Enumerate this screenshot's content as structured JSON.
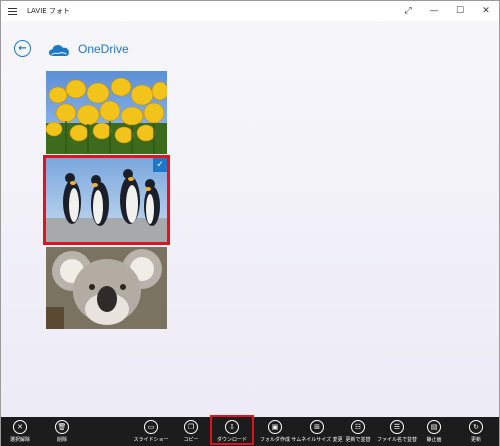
{
  "window": {
    "app_title": "LAVIE フォト",
    "controls": [
      "⤢",
      "—",
      "☐",
      "✕"
    ]
  },
  "header": {
    "back_icon": "back-arrow-icon",
    "location_icon": "onedrive-cloud-icon",
    "title": "OneDrive"
  },
  "photos": [
    {
      "subject": "tulips",
      "selected": false
    },
    {
      "subject": "penguins",
      "selected": true
    },
    {
      "subject": "koala",
      "selected": false
    }
  ],
  "colors": {
    "accent": "#1e78c8",
    "selection_outline": "#e0141e",
    "appbar_bg": "#1c1c1c"
  },
  "appbar": {
    "buttons": [
      {
        "label": "選択解除",
        "icon": "close-icon",
        "glyph": "✕"
      },
      {
        "label": "削除",
        "icon": "trash-icon",
        "glyph": "🗑"
      },
      {
        "label": "スライドショー",
        "icon": "slideshow-icon",
        "glyph": "▭"
      },
      {
        "label": "コピー",
        "icon": "copy-icon",
        "glyph": "❐"
      },
      {
        "label": "ダウンロード",
        "icon": "download-icon",
        "glyph": "⇩"
      },
      {
        "label": "フォルダ作成",
        "icon": "folder-add-icon",
        "glyph": "▣"
      },
      {
        "label": "サムネイルサイズ 変更",
        "icon": "thumbnail-size-icon",
        "glyph": "⊞"
      },
      {
        "label": "更新で並替",
        "icon": "sort-date-icon",
        "glyph": "☷"
      },
      {
        "label": "ファイル名で並替",
        "icon": "sort-name-icon",
        "glyph": "☰"
      },
      {
        "label": "静止画",
        "icon": "still-image-icon",
        "glyph": "▤"
      },
      {
        "label": "更新",
        "icon": "refresh-icon",
        "glyph": "↻"
      }
    ]
  }
}
